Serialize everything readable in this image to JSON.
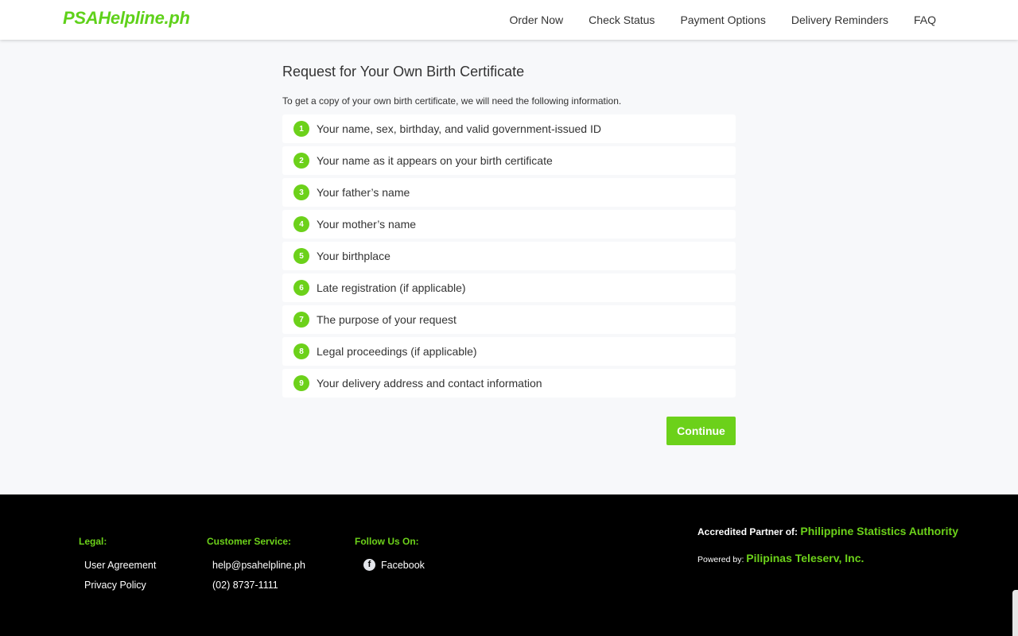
{
  "header": {
    "logo": "PSAHelpline.ph",
    "nav": [
      "Order Now",
      "Check Status",
      "Payment Options",
      "Delivery Reminders",
      "FAQ"
    ]
  },
  "main": {
    "title": "Request for Your Own Birth Certificate",
    "intro": "To get a copy of your own birth certificate, we will need the following information.",
    "items": [
      {
        "num": "1",
        "label": "Your name, sex, birthday, and valid government-issued ID"
      },
      {
        "num": "2",
        "label": "Your name as it appears on your birth certificate"
      },
      {
        "num": "3",
        "label": "Your father’s name"
      },
      {
        "num": "4",
        "label": "Your mother’s name"
      },
      {
        "num": "5",
        "label": "Your birthplace"
      },
      {
        "num": "6",
        "label": "Late registration (if applicable)"
      },
      {
        "num": "7",
        "label": "The purpose of your request"
      },
      {
        "num": "8",
        "label": "Legal proceedings (if applicable)"
      },
      {
        "num": "9",
        "label": "Your delivery address and contact information"
      }
    ],
    "continue_label": "Continue"
  },
  "footer": {
    "legal": {
      "heading": "Legal:",
      "links": [
        "User Agreement",
        "Privacy Policy"
      ]
    },
    "customer_service": {
      "heading": "Customer Service:",
      "email": "help@psahelpline.ph",
      "phone": "(02) 8737-1111"
    },
    "follow": {
      "heading": "Follow Us On:",
      "facebook": "Facebook",
      "icon": "facebook-icon"
    },
    "accredited_prefix": "Accredited Partner of:",
    "accredited_name": "Philippine Statistics Authority",
    "powered_prefix": "Powered by:",
    "powered_name": "Pilipinas Teleserv, Inc."
  },
  "colors": {
    "accent": "#6cd11a",
    "footer_bg": "#000000",
    "page_bg": "#f7f8fa"
  }
}
